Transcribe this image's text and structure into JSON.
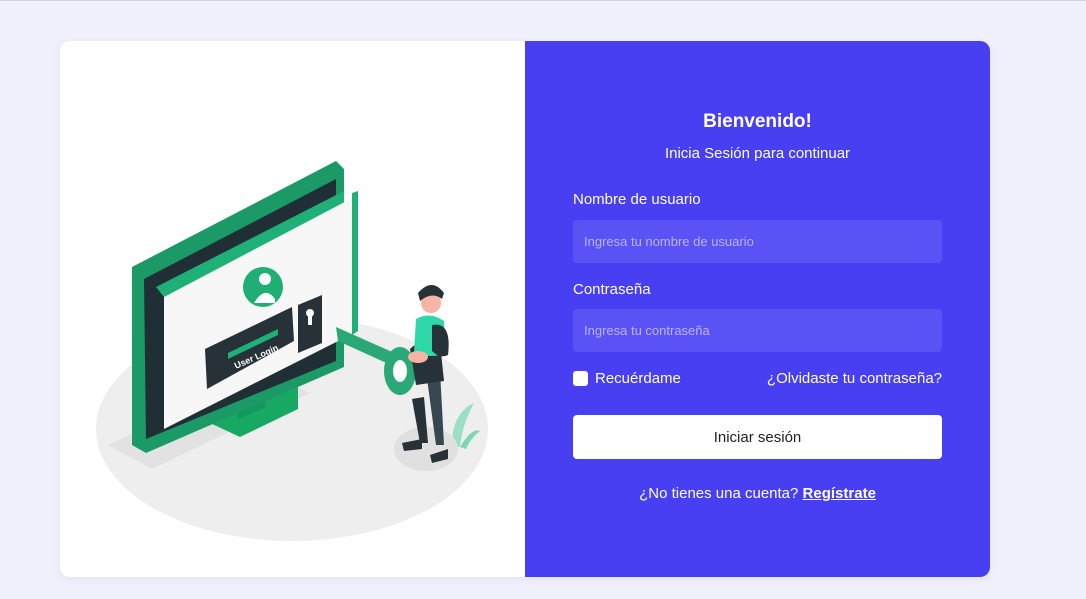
{
  "colors": {
    "page_background": "#f0f0fc",
    "panel_accent": "#483ef2",
    "input_background": "#5a52f5",
    "illustration_green": "#1ea672"
  },
  "illustration": {
    "screen_text": "User Login",
    "icons": [
      "monitor-icon",
      "user-avatar-icon",
      "key-icon",
      "keyhole-icon",
      "person-figure",
      "plant-icon"
    ]
  },
  "login": {
    "title": "Bienvenido!",
    "subtitle": "Inicia Sesión para continuar",
    "username_label": "Nombre de usuario",
    "username_placeholder": "Ingresa tu nombre de usuario",
    "username_value": "",
    "password_label": "Contraseña",
    "password_placeholder": "Ingresa tu contraseña",
    "password_value": "",
    "remember_label": "Recuérdame",
    "remember_checked": false,
    "forgot_link": "¿Olvidaste tu contraseña?",
    "submit_label": "Iniciar sesión",
    "signup_prompt": "¿No tienes una cuenta?",
    "signup_link": "Regístrate"
  }
}
